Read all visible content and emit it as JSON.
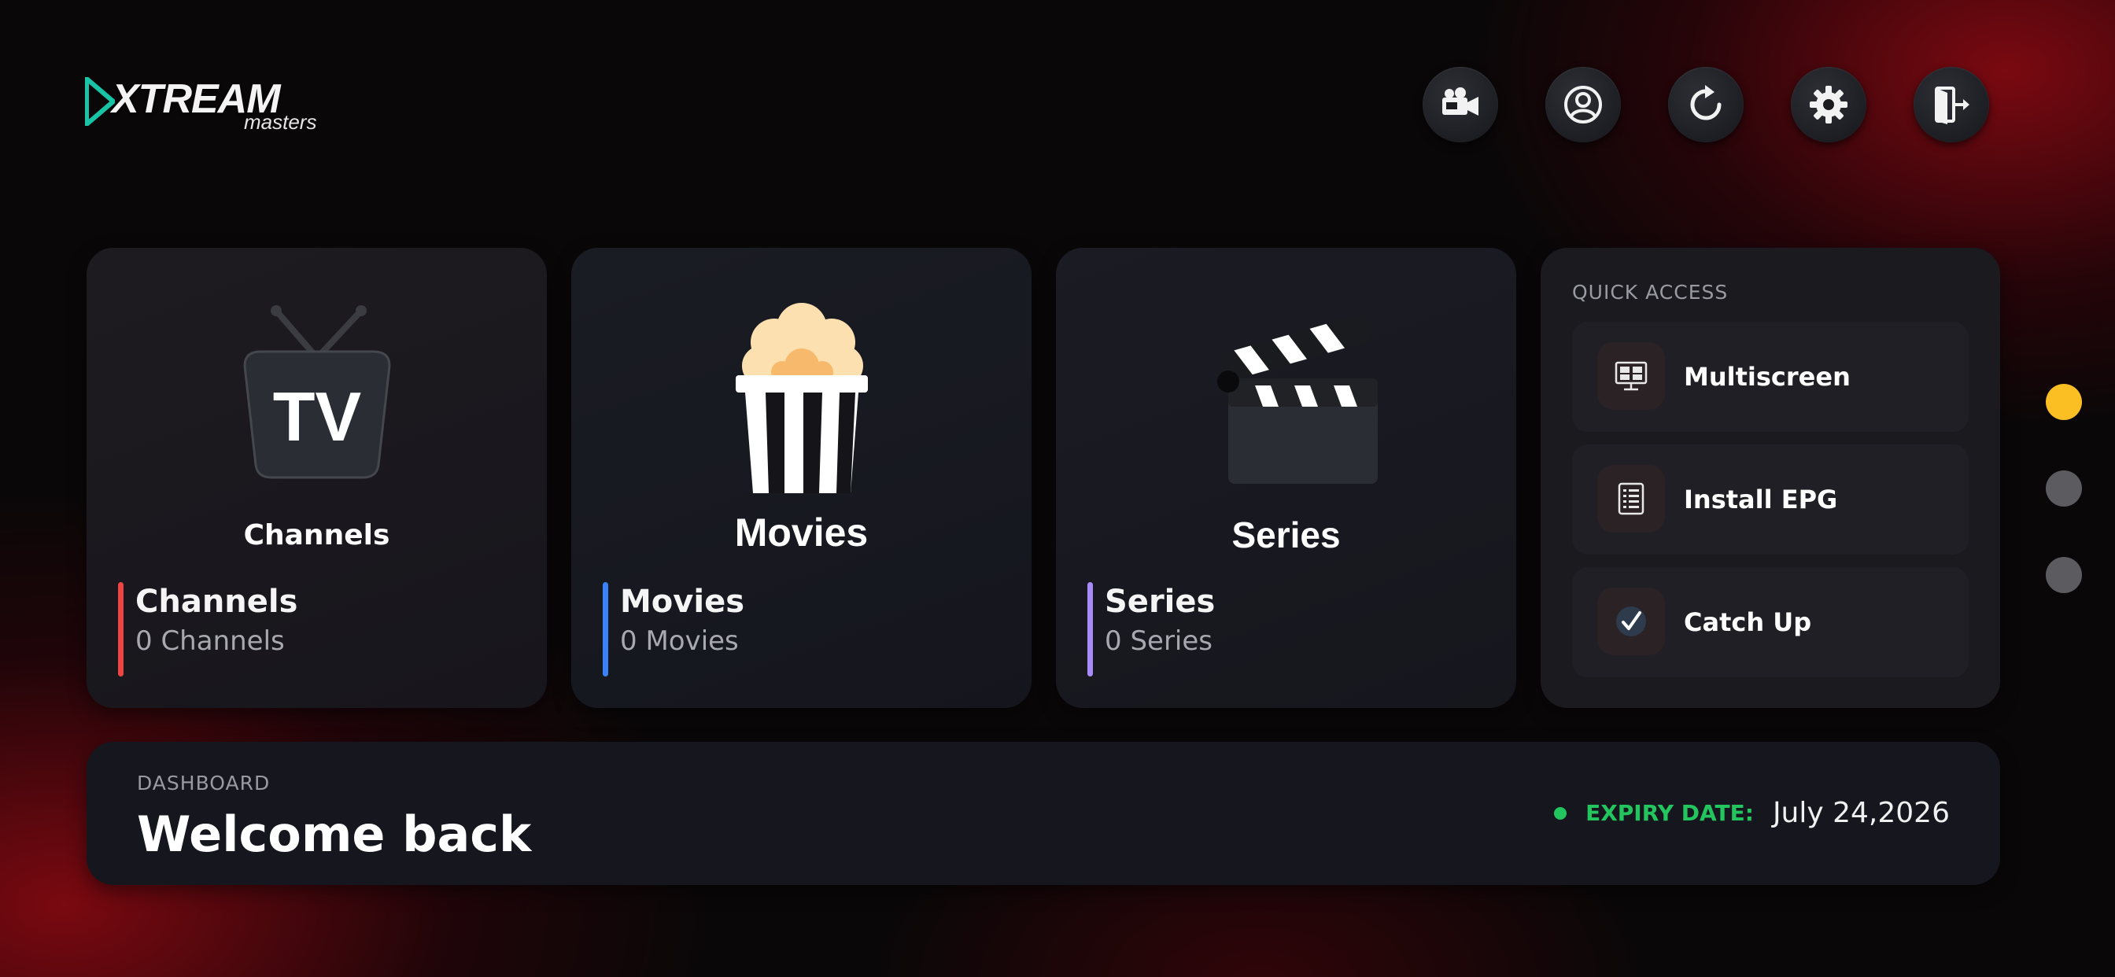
{
  "logo": {
    "brand": "XTREAM",
    "sub": "masters"
  },
  "toolbar": {
    "icons": [
      "video-camera-icon",
      "user-profile-icon",
      "refresh-icon",
      "settings-gear-icon",
      "logout-door-icon"
    ]
  },
  "cards": {
    "channels": {
      "caption": "Channels",
      "title": "Channels",
      "count": "0 Channels",
      "accent": "#ef4444",
      "icon": "tv-icon"
    },
    "movies": {
      "caption": "Movies",
      "title": "Movies",
      "count": "0 Movies",
      "accent": "#3b82f6",
      "icon": "popcorn-icon"
    },
    "series": {
      "caption": "Series",
      "title": "Series",
      "count": "0 Series",
      "accent": "#a78bfa",
      "icon": "clapperboard-icon"
    }
  },
  "quick_access": {
    "header": "QUICK ACCESS",
    "items": [
      {
        "label": "Multiscreen",
        "icon": "multiscreen-icon"
      },
      {
        "label": "Install EPG",
        "icon": "epg-list-icon"
      },
      {
        "label": "Catch Up",
        "icon": "checkmark-icon"
      }
    ]
  },
  "pager": {
    "active_index": 0,
    "count": 3,
    "active_color": "#fbbf24",
    "inactive_color": "#5c5c60"
  },
  "dashboard": {
    "label": "DASHBOARD",
    "welcome": "Welcome back",
    "expiry_label": "EXPIRY DATE:",
    "expiry_date": "July 24,2026",
    "status_color": "#22c55e"
  }
}
